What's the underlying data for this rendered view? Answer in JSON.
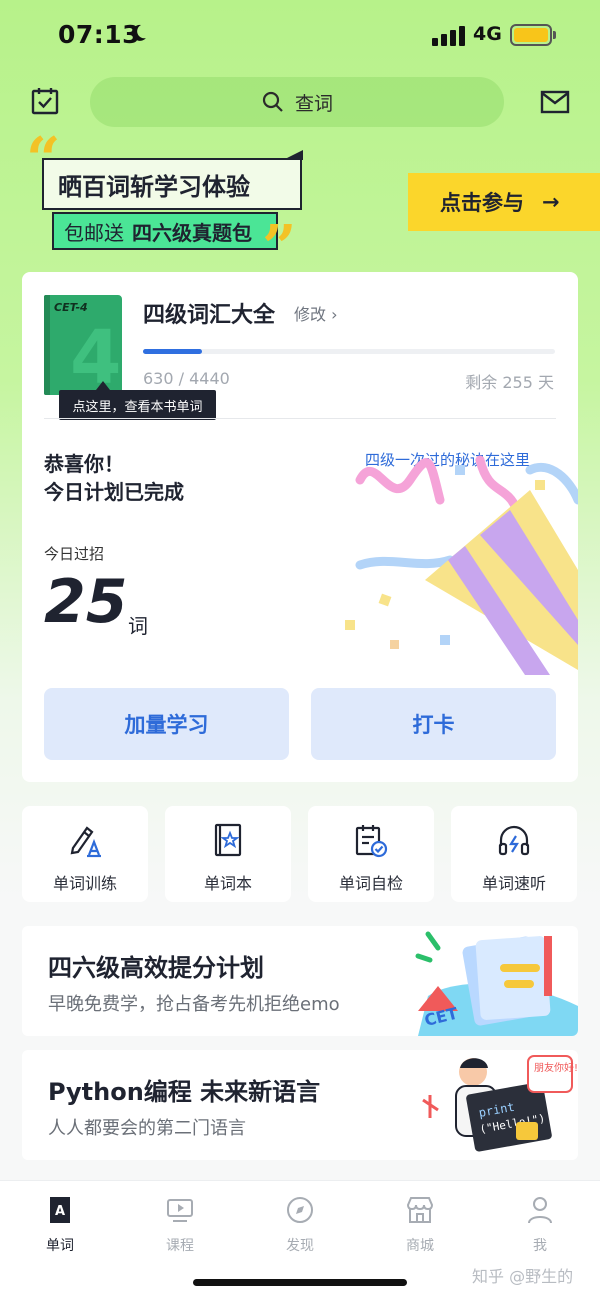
{
  "status_bar": {
    "time": "07:13",
    "network": "4G"
  },
  "header": {
    "search_placeholder": "查词",
    "icons": [
      "calendar-check-icon",
      "search-icon",
      "mail-icon"
    ]
  },
  "promo_banner": {
    "title": "晒百词斩学习体验",
    "subtitle_prefix": "包邮送",
    "subtitle_bold": "四六级真题包",
    "cta_label": "点击参与",
    "cta_arrow": "→"
  },
  "book": {
    "cover_label": "CET-4",
    "cover_number": "4",
    "title": "四级词汇大全",
    "edit_label": "修改",
    "progress_text": "630 / 4440",
    "progress_fraction": 0.142,
    "remaining_text": "剩余 255 天",
    "tooltip": "点这里，查看本书单词"
  },
  "today": {
    "congrats_line1": "恭喜你！",
    "congrats_line2": "今日计划已完成",
    "secret_link": "四级一次过的秘诀在这里",
    "count_label": "今日过招",
    "count": "25",
    "count_unit": "词"
  },
  "actions": {
    "more_study": "加量学习",
    "check_in": "打卡"
  },
  "quick_tiles": [
    {
      "label": "单词训练",
      "icon": "pencil-a-icon"
    },
    {
      "label": "单词本",
      "icon": "star-book-icon"
    },
    {
      "label": "单词自检",
      "icon": "calendar-check-icon"
    },
    {
      "label": "单词速听",
      "icon": "headphones-icon"
    }
  ],
  "promo_cards": [
    {
      "title": "四六级高效提分计划",
      "subtitle": "早晚免费学，抢占备考先机拒绝emo",
      "art_text": "CET"
    },
    {
      "title": "Python编程 未来新语言",
      "subtitle": "人人都要会的第二门语言",
      "art_text_1": "print",
      "art_text_2": "(\"Hello!\")",
      "bubble": "朋友你好!"
    }
  ],
  "tabs": [
    {
      "label": "单词",
      "icon": "book-a-icon",
      "active": true
    },
    {
      "label": "课程",
      "icon": "video-icon",
      "active": false
    },
    {
      "label": "发现",
      "icon": "compass-icon",
      "active": false
    },
    {
      "label": "商城",
      "icon": "store-icon",
      "active": false
    },
    {
      "label": "我",
      "icon": "person-icon",
      "active": false
    }
  ],
  "watermark": "知乎 @野生的",
  "colors": {
    "accent_blue": "#2e6bd9",
    "brand_green": "#b7f28a",
    "cta_yellow": "#fbd62b",
    "dark": "#1f2330"
  }
}
